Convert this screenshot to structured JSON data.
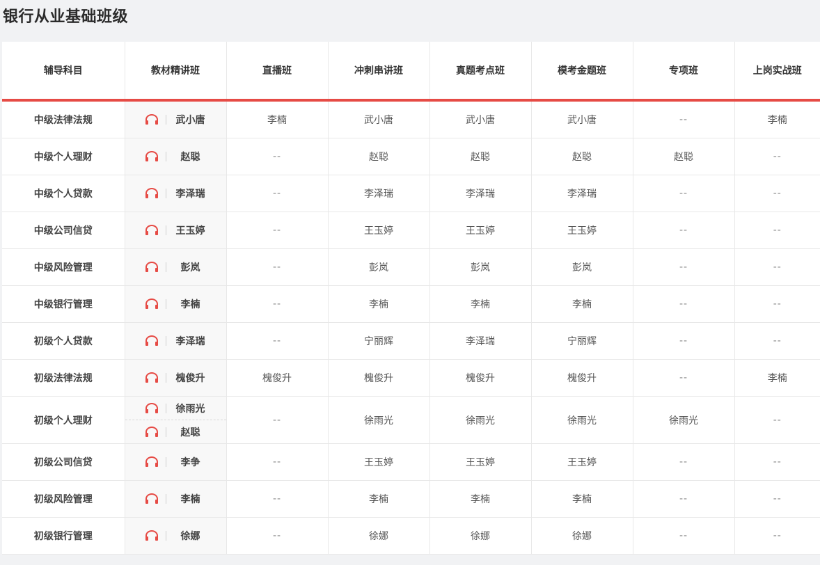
{
  "page": {
    "title": "银行从业基础班级",
    "accent_color": "#e64b45"
  },
  "headers": [
    "辅导科目",
    "教材精讲班",
    "直播班",
    "冲刺串讲班",
    "真题考点班",
    "模考金题班",
    "专项班",
    "上岗实战班"
  ],
  "icon": "headphones-icon",
  "rows": [
    {
      "subject": "中级法律法规",
      "teachers": [
        "武小唐"
      ],
      "cells": [
        "李楠",
        "武小唐",
        "武小唐",
        "武小唐",
        "--",
        "李楠"
      ]
    },
    {
      "subject": "中级个人理财",
      "teachers": [
        "赵聪"
      ],
      "cells": [
        "--",
        "赵聪",
        "赵聪",
        "赵聪",
        "赵聪",
        "--"
      ]
    },
    {
      "subject": "中级个人贷款",
      "teachers": [
        "李泽瑞"
      ],
      "cells": [
        "--",
        "李泽瑞",
        "李泽瑞",
        "李泽瑞",
        "--",
        "--"
      ]
    },
    {
      "subject": "中级公司信贷",
      "teachers": [
        "王玉婷"
      ],
      "cells": [
        "--",
        "王玉婷",
        "王玉婷",
        "王玉婷",
        "--",
        "--"
      ]
    },
    {
      "subject": "中级风险管理",
      "teachers": [
        "彭岚"
      ],
      "cells": [
        "--",
        "彭岚",
        "彭岚",
        "彭岚",
        "--",
        "--"
      ]
    },
    {
      "subject": "中级银行管理",
      "teachers": [
        "李楠"
      ],
      "cells": [
        "--",
        "李楠",
        "李楠",
        "李楠",
        "--",
        "--"
      ]
    },
    {
      "subject": "初级个人贷款",
      "teachers": [
        "李泽瑞"
      ],
      "cells": [
        "--",
        "宁丽辉",
        "李泽瑞",
        "宁丽辉",
        "--",
        "--"
      ]
    },
    {
      "subject": "初级法律法规",
      "teachers": [
        "槐俊升"
      ],
      "cells": [
        "槐俊升",
        "槐俊升",
        "槐俊升",
        "槐俊升",
        "--",
        "李楠"
      ]
    },
    {
      "subject": "初级个人理财",
      "teachers": [
        "徐雨光",
        "赵聪"
      ],
      "cells": [
        "--",
        "徐雨光",
        "徐雨光",
        "徐雨光",
        "徐雨光",
        "--"
      ]
    },
    {
      "subject": "初级公司信贷",
      "teachers": [
        "李争"
      ],
      "cells": [
        "--",
        "王玉婷",
        "王玉婷",
        "王玉婷",
        "--",
        "--"
      ]
    },
    {
      "subject": "初级风险管理",
      "teachers": [
        "李楠"
      ],
      "cells": [
        "--",
        "李楠",
        "李楠",
        "李楠",
        "--",
        "--"
      ]
    },
    {
      "subject": "初级银行管理",
      "teachers": [
        "徐娜"
      ],
      "cells": [
        "--",
        "徐娜",
        "徐娜",
        "徐娜",
        "--",
        "--"
      ]
    }
  ]
}
